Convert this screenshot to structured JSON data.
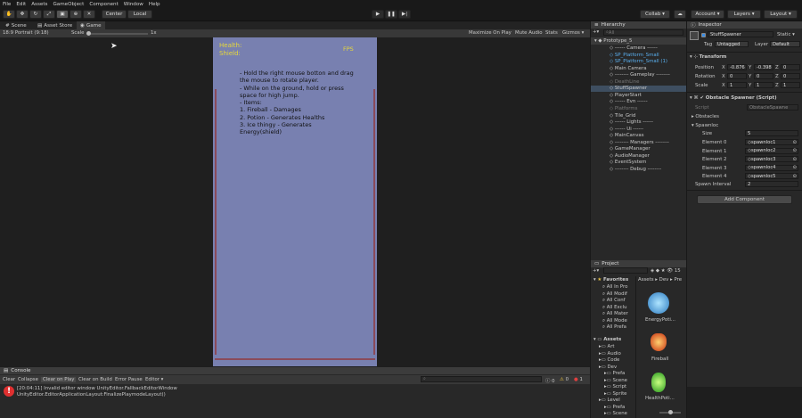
{
  "menu": [
    "File",
    "Edit",
    "Assets",
    "GameObject",
    "Component",
    "Window",
    "Help"
  ],
  "toolbar": {
    "pivot": "Center",
    "space": "Local",
    "collab": "Collab ▾",
    "account": "Account ▾",
    "layers": "Layers ▾",
    "layout": "Layout ▾"
  },
  "tabs": {
    "scene": "Scene",
    "asset_store": "Asset Store",
    "game": "Game"
  },
  "game_bar": {
    "aspect": "18:9 Portrait (9:18)",
    "scale_label": "Scale",
    "scale_value": "1x",
    "maximize": "Maximize On Play",
    "mute": "Mute Audio",
    "stats": "Stats",
    "gizmos": "Gizmos ▾"
  },
  "game_view": {
    "health": "Health:",
    "shield": "Shield:",
    "fps": "FPS",
    "instructions": [
      "- Hold the right mouse botton and drag",
      "the mouse to rotate player.",
      "- While on the ground, hold or press",
      "space for high jump.",
      "- Items:",
      "1. Fireball - Damages",
      "2. Potion - Generates Healths",
      "3. Ice thingy - Generates",
      "Energy(shield)"
    ],
    "bg_color": "#7880b0"
  },
  "hierarchy": {
    "title": "Hierarchy",
    "search": "All",
    "scene": "Prototype_5",
    "items": [
      "------ Camera ------",
      "SP_Platform_Small",
      "SP_Platform_Small (1)",
      "Main Camera",
      "-------- Gameplay --------",
      "DeathLine",
      "StuffSpawner",
      "PlayerStart",
      "------ Evn ------",
      "Platforms",
      "Tile_Grid",
      "------ Lights ------",
      "------ Ui ------",
      "MainCanvas",
      "-------- Managers --------",
      "GameManager",
      "AudioManager",
      "EventSystem",
      "-------- Debug --------"
    ]
  },
  "project": {
    "title": "Project",
    "favorites_label": "Favorites",
    "favorites": [
      "All In Pro",
      "All Modif",
      "All Conf",
      "All Exclu",
      "All Mater",
      "All Mode",
      "All Prefa"
    ],
    "assets_label": "Assets",
    "assets": [
      "Art",
      "Audio",
      "Code",
      "Dev",
      "Prefa",
      "Scene",
      "Script",
      "Sprite",
      "Level",
      "Prefa",
      "Scene"
    ],
    "breadcrumb": "Assets ▸ Dev ▸ Pre",
    "files": [
      "EnergyPoti...",
      "Fireball",
      "HealthPoti..."
    ]
  },
  "inspector": {
    "title": "Inspector",
    "object_name": "StuffSpawner",
    "static": "Static ▾",
    "tag_label": "Tag",
    "tag": "Untagged",
    "layer_label": "Layer",
    "layer": "Default",
    "transform": "Transform",
    "position_label": "Position",
    "rotation_label": "Rotation",
    "scale_label": "Scale",
    "position": {
      "x": "-0.876",
      "y": "-0.398",
      "z": "0"
    },
    "rotation": {
      "x": "0",
      "y": "0",
      "z": "0"
    },
    "scale": {
      "x": "1",
      "y": "1",
      "z": "1"
    },
    "component": "Obstacle Spawner (Script)",
    "script_label": "Script",
    "script": "ObstacleSpawne",
    "obstacles": "Obstacles",
    "spawnloc": "Spawnloc",
    "size_label": "Size",
    "size": "5",
    "elements": [
      {
        "label": "Element 0",
        "value": "spawnloc1"
      },
      {
        "label": "Element 1",
        "value": "spawnloc2"
      },
      {
        "label": "Element 2",
        "value": "spawnloc3"
      },
      {
        "label": "Element 3",
        "value": "spawnloc4"
      },
      {
        "label": "Element 4",
        "value": "spawnloc5"
      }
    ],
    "interval_label": "Spawn Interval",
    "interval": "2",
    "add_component": "Add Component"
  },
  "console": {
    "title": "Console",
    "clear": "Clear",
    "collapse": "Collapse",
    "clear_on_play": "Clear on Play",
    "clear_on_build": "Clear on Build",
    "error_pause": "Error Pause",
    "editor": "Editor ▾",
    "count_info": "0",
    "count_warn": "0",
    "count_error": "1",
    "msg1": "[20:04:11] Invalid editor window UnityEditor.FallbackEditorWindow",
    "msg2": "UnityEditor.EditorApplicationLayout:FinalizePlaymodeLayout()"
  }
}
